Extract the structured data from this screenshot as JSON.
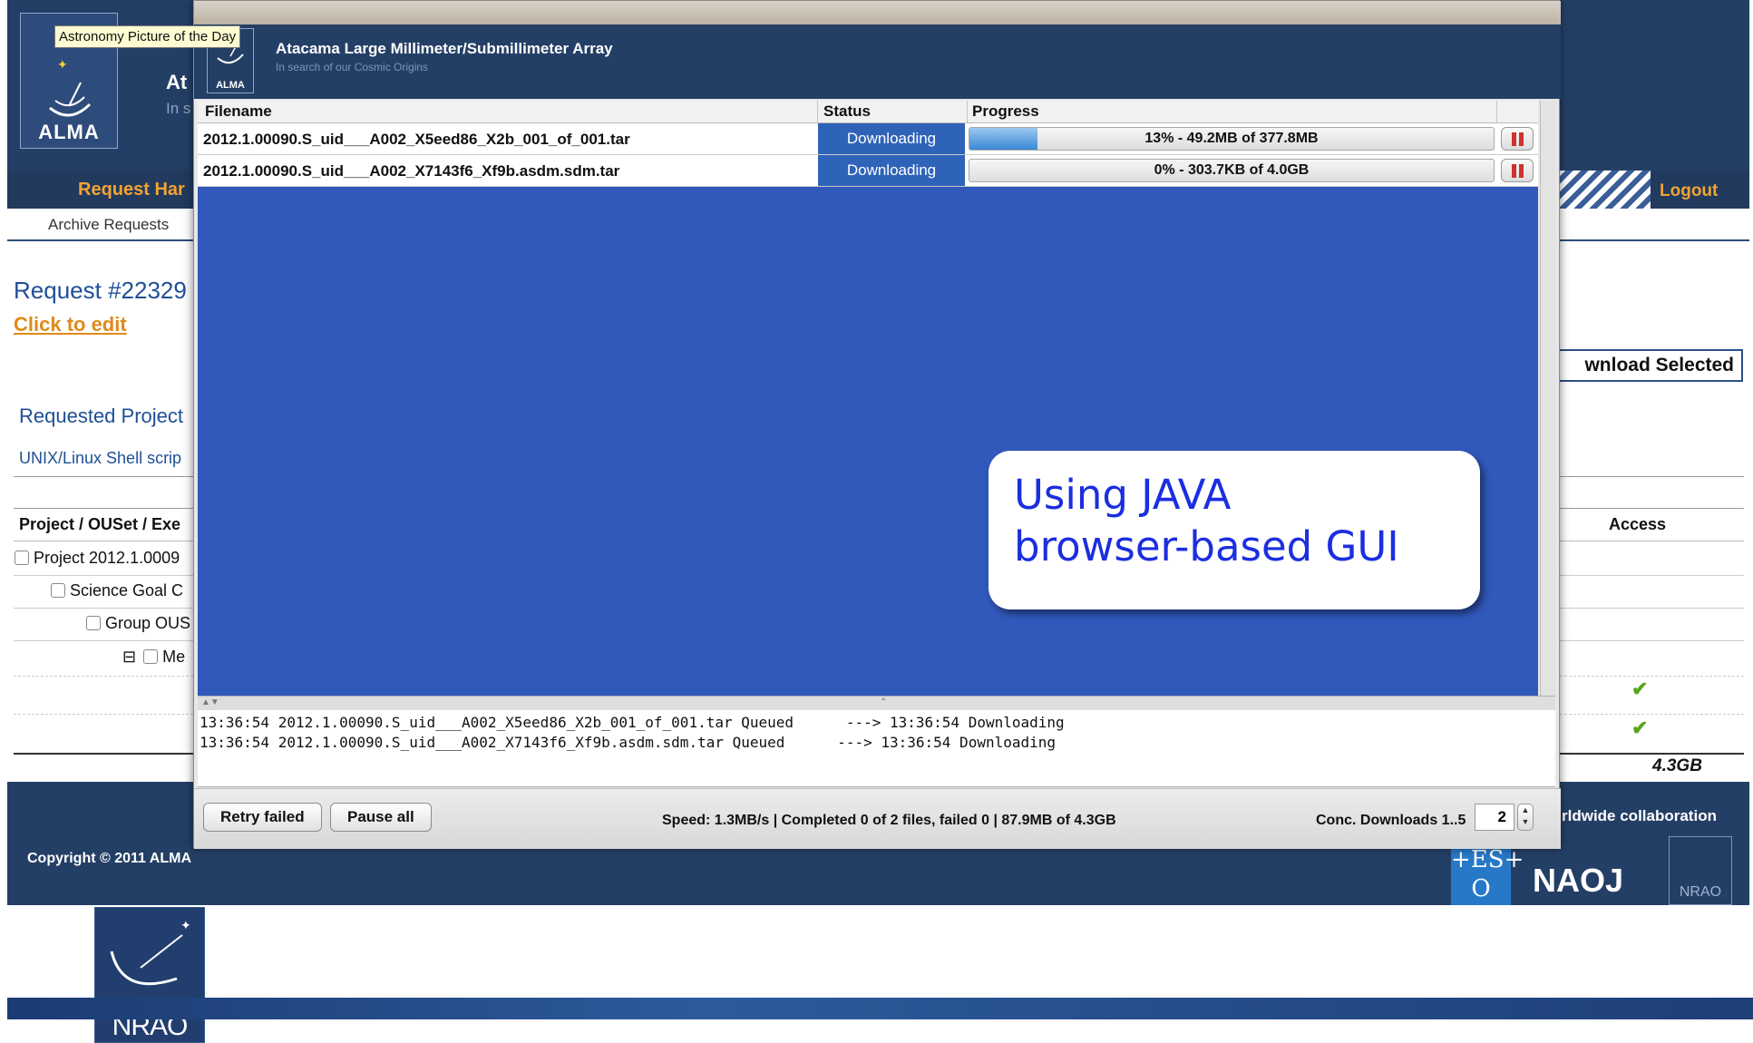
{
  "background_page": {
    "tooltip": "Astronomy Picture of the Day",
    "logo_text": "ALMA",
    "title_fragment": "At",
    "subtitle_fragment": "In s",
    "nav": {
      "request_handler": "Request Har",
      "logout": "Logout"
    },
    "subnav": {
      "archive_requests": "Archive Requests"
    },
    "request_number": "Request #22329",
    "click_to_edit": "Click to edit",
    "download_selected": "wnload Selected",
    "requested_projects": "Requested Project",
    "unix_shell": "UNIX/Linux Shell scrip",
    "columns": {
      "project": "Project / OUSet / Exe",
      "access": "Access"
    },
    "rows": [
      {
        "label": "Project 2012.1.0009"
      },
      {
        "label": "Science Goal C"
      },
      {
        "label": "Group OUS"
      },
      {
        "toggle": "⊟",
        "label": "Me"
      }
    ],
    "access_checks": [
      "✔",
      "✔"
    ],
    "total_size": "4.3GB",
    "footer": {
      "copyright": "Copyright © 2011 ALMA",
      "collaboration": "rldwide collaboration",
      "eso_logo": "+ES+\nO",
      "naoj_logo": "NAOJ",
      "nrao_small_logo": "NRAO"
    },
    "nrao_logo": "NRAO"
  },
  "downloader": {
    "banner_logo_text": "ALMA",
    "title": "Atacama Large Millimeter/Submillimeter Array",
    "subtitle": "In search of our Cosmic Origins",
    "table_headers": {
      "filename": "Filename",
      "status": "Status",
      "progress": "Progress"
    },
    "files": [
      {
        "filename": "2012.1.00090.S_uid___A002_X5eed86_X2b_001_of_001.tar",
        "status": "Downloading",
        "progress_text": "13% - 49.2MB of 377.8MB",
        "progress_fraction": 0.13
      },
      {
        "filename": "2012.1.00090.S_uid___A002_X7143f6_Xf9b.asdm.sdm.tar",
        "status": "Downloading",
        "progress_text": "0% - 303.7KB of 4.0GB",
        "progress_fraction": 0.0
      }
    ],
    "log": [
      "13:36:54 2012.1.00090.S_uid___A002_X5eed86_X2b_001_of_001.tar Queued      ---> 13:36:54 Downloading",
      "13:36:54 2012.1.00090.S_uid___A002_X7143f6_Xf9b.asdm.sdm.tar Queued      ---> 13:36:54 Downloading"
    ],
    "buttons": {
      "retry_failed": "Retry failed",
      "pause_all": "Pause all"
    },
    "status_line": "Speed: 1.3MB/s | Completed 0 of 2 files, failed 0 | 87.9MB of 4.3GB",
    "conc_label": "Conc. Downloads 1..5",
    "conc_value": "2"
  },
  "callout": {
    "text": "Using JAVA\nbrowser-based GUI"
  },
  "colors": {
    "accent_orange": "#f2a332",
    "navy": "#243f66",
    "table_blue": "#3158bb",
    "status_blue": "#2f63b8",
    "callout_text": "#1b2ee0"
  }
}
